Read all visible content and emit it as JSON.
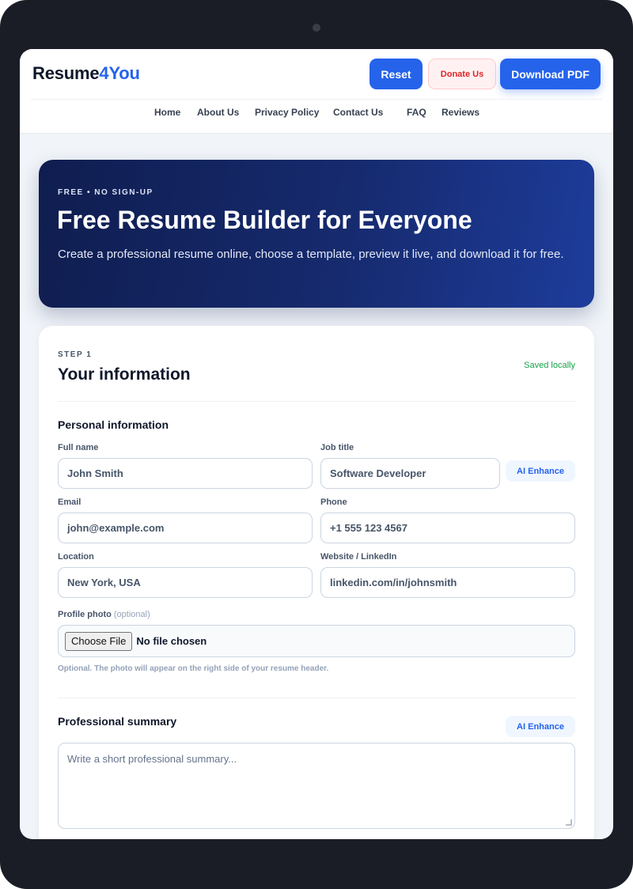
{
  "brand": {
    "name_part1": "Resume",
    "name_part2": "4You",
    "accent_color": "#2563eb"
  },
  "header_buttons": {
    "reset": "Reset",
    "donate": "Donate Us",
    "download": "Download PDF"
  },
  "nav": [
    {
      "label": "Home"
    },
    {
      "label": "About Us"
    },
    {
      "label": "Privacy Policy"
    },
    {
      "label": "Contact Us"
    },
    {
      "label": "FAQ"
    },
    {
      "label": "Reviews"
    }
  ],
  "hero": {
    "kicker": "FREE • NO SIGN-UP",
    "title": "Free Resume Builder for Everyone",
    "subtitle": "Create a professional resume online, choose a template, preview it live, and download it for free."
  },
  "form": {
    "step": "STEP 1",
    "title": "Your information",
    "save_status": "Saved locally",
    "personal": {
      "heading": "Personal information",
      "full_name": {
        "label": "Full name",
        "value": "John Smith"
      },
      "job_title": {
        "label": "Job title",
        "value": "Software Developer"
      },
      "email": {
        "label": "Email",
        "value": "john@example.com"
      },
      "phone": {
        "label": "Phone",
        "value": "+1 555 123 4567"
      },
      "location": {
        "label": "Location",
        "value": "New York, USA"
      },
      "website": {
        "label": "Website / LinkedIn",
        "value": "linkedin.com/in/johnsmith"
      },
      "photo": {
        "label": "Profile photo",
        "optional": "(optional)",
        "button": "Choose File",
        "status": "No file chosen",
        "hint": "Optional. The photo will appear on the right side of your resume header."
      },
      "ai_enhance": "AI Enhance"
    },
    "summary": {
      "heading": "Professional summary",
      "ai_enhance": "AI Enhance",
      "placeholder": "Write a short professional summary..."
    }
  }
}
